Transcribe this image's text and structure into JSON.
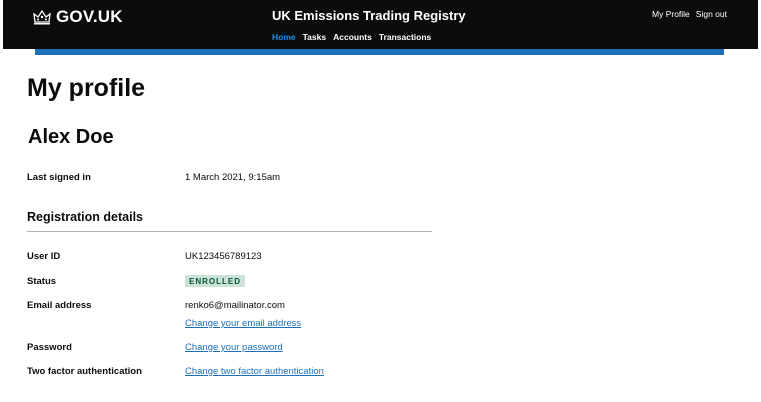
{
  "header": {
    "logo_text": "GOV.UK",
    "service_name": "UK Emissions Trading Registry",
    "nav": [
      {
        "label": "Home",
        "active": true
      },
      {
        "label": "Tasks",
        "active": false
      },
      {
        "label": "Accounts",
        "active": false
      },
      {
        "label": "Transactions",
        "active": false
      }
    ],
    "account_links": {
      "my_profile": "My Profile",
      "sign_out": "Sign out"
    },
    "colors": {
      "background": "#0b0c0c",
      "accent_bar": "#1d70b8",
      "active_nav": "#1d8feb"
    },
    "logo_icon": "crown-icon"
  },
  "main": {
    "title": "My profile",
    "user_name": "Alex Doe",
    "last_signed_in": {
      "label": "Last signed in",
      "value": "1 March 2021, 9:15am"
    },
    "registration": {
      "heading": "Registration details",
      "user_id": {
        "label": "User ID",
        "value": "UK123456789123"
      },
      "status": {
        "label": "Status",
        "value": "ENROLLED",
        "color": "#005a30",
        "background": "#cce2d8"
      },
      "email": {
        "label": "Email address",
        "value": "renko6@mailinator.com",
        "change_link": "Change your email address"
      },
      "password": {
        "label": "Password",
        "change_link": "Change your password"
      },
      "two_factor": {
        "label": "Two factor authentication",
        "change_link": "Change two factor authentication"
      }
    }
  }
}
